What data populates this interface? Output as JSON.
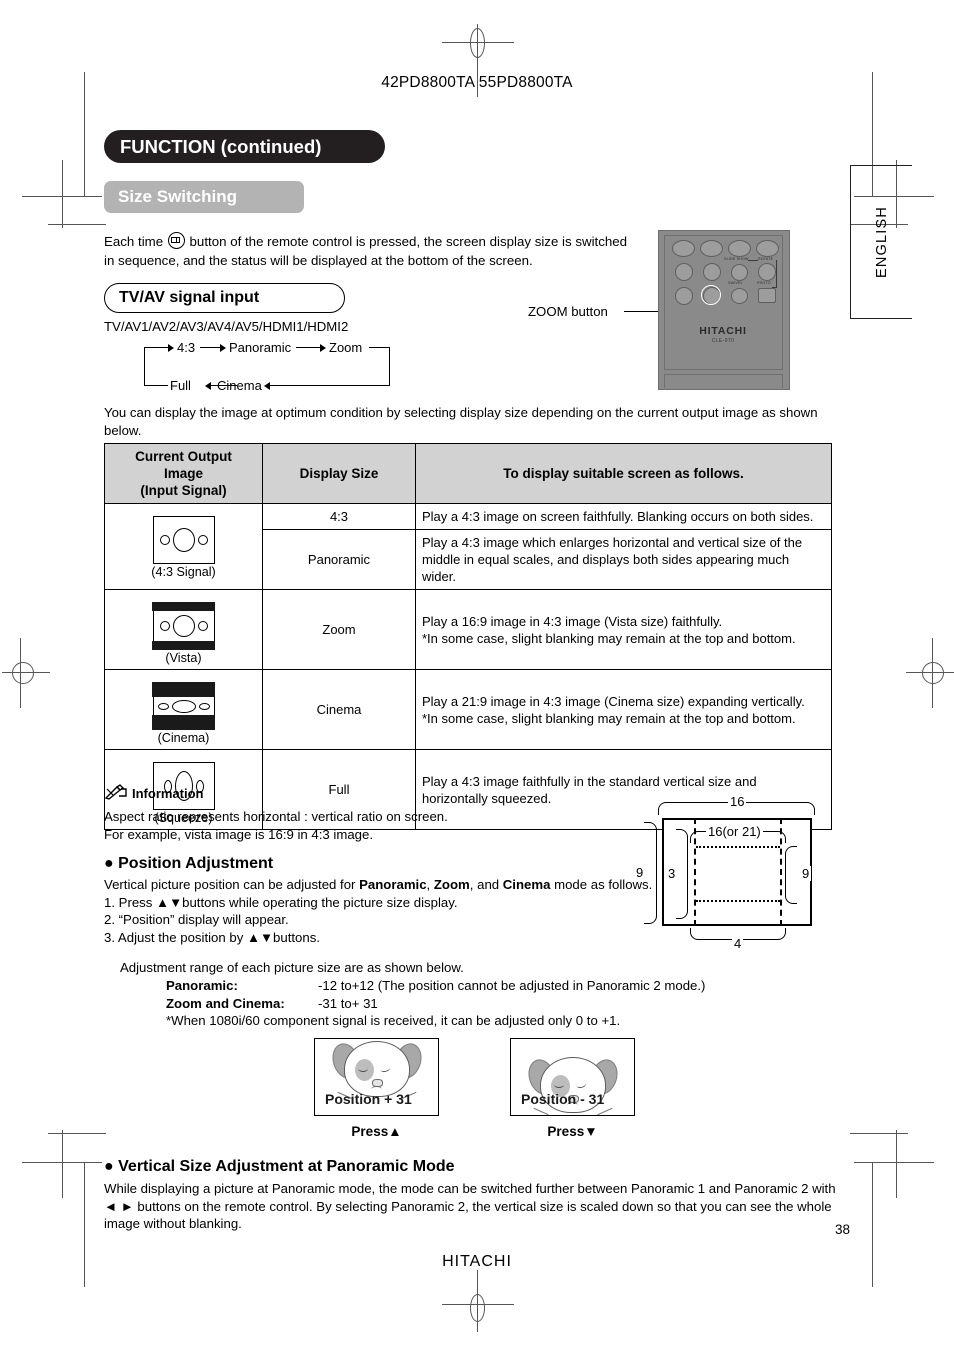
{
  "header": {
    "models": "42PD8800TA  55PD8800TA",
    "title": "FUNCTION (continued)",
    "section": "Size Switching",
    "language_tab": "ENGLISH"
  },
  "intro": {
    "before_icon": "Each time",
    "after_icon": "button of the remote control is pressed, the screen display size is switched in sequence, and the status will be displayed at the bottom of the screen."
  },
  "tvav": {
    "box_label": "TV/AV signal input",
    "inputs": "TV/AV1/AV2/AV3/AV4/AV5/HDMI1/HDMI2",
    "flow": [
      "4:3",
      "Panoramic",
      "Zoom",
      "Cinema",
      "Full"
    ]
  },
  "remote": {
    "callout": "ZOOM button",
    "brand": "HITACHI",
    "model": "CLE-970",
    "labels": {
      "slide_show": "SLIDE SHOW",
      "rotate": "ROTATE",
      "swivel": "SWIVEL",
      "photo": "PHOTO"
    }
  },
  "paragraph_below": "You can display the image at optimum condition by selecting display size depending on the current output image as shown below.",
  "table": {
    "headers": [
      "Current Output Image (Input Signal)",
      "Display Size",
      "To display suitable screen as follows."
    ],
    "header_lines": {
      "col1": [
        "Current Output",
        "Image",
        "(Input Signal)"
      ],
      "col2": "Display Size",
      "col3": "To display suitable screen as follows."
    },
    "rows": [
      {
        "image_label": "(4:3 Signal)",
        "image_type": "4to3",
        "display_size": "4:3",
        "description": "Play a 4:3 image on screen faithfully. Blanking occurs on both sides."
      },
      {
        "image_label": "(4:3 Signal)",
        "image_type": "4to3",
        "display_size": "Panoramic",
        "description": "Play a 4:3 image which enlarges horizontal and vertical size of the middle in equal scales, and displays both sides appearing much wider."
      },
      {
        "image_label": "(Vista)",
        "image_type": "vista",
        "display_size": "Zoom",
        "description": "Play a 16:9 image in 4:3 image (Vista size) faithfully.\n*In some case, slight blanking may remain at the top and bottom."
      },
      {
        "image_label": "(Cinema)",
        "image_type": "cinema",
        "display_size": "Cinema",
        "description": "Play a 21:9 image in 4:3 image (Cinema size) expanding vertically.\n*In some case, slight blanking may remain at the top and bottom."
      },
      {
        "image_label": "(Squeeze)",
        "image_type": "squeeze",
        "display_size": "Full",
        "description": "Play a 4:3 image faithfully in the standard vertical size and horizontally squeezed."
      }
    ]
  },
  "information": {
    "heading": "Information",
    "line1": "Aspect ratio represents horizontal : vertical ratio on screen.",
    "line2": "For example, vista image is 16:9 in 4:3 image."
  },
  "ratio_diagram": {
    "top": "16",
    "inner_top": "16(or 21)",
    "left_outer": "9",
    "left_inner": "3",
    "right": "9",
    "bottom": "4"
  },
  "position_adjustment": {
    "heading": "Position Adjustment",
    "intro_a": "Vertical picture position can be adjusted for ",
    "bold1": "Panoramic",
    "sep1": ", ",
    "bold2": "Zoom",
    "sep2": ", and ",
    "bold3": "Cinema",
    "intro_b": " mode as follows.",
    "step1": "1. Press ▲▼buttons while operating the picture size display.",
    "step2": "2. “Position” display will appear.",
    "step3": "3. Adjust the position by ▲▼buttons.",
    "step3_sub": "Adjustment range of each picture size are as shown below.",
    "range_panoramic_label": "Panoramic",
    "range_panoramic_colon": ":",
    "range_panoramic_value": "-12 to+12  (The position cannot be adjusted in Panoramic 2 mode.)",
    "range_zoomcinema_label_a": "Zoom",
    "range_zoomcinema_label_mid": " and ",
    "range_zoomcinema_label_b": "Cinema",
    "range_zoomcinema_colon": ":",
    "range_zoomcinema_value": "-31 to+ 31",
    "range_note": "*When 1080i/60 component signal is received, it can be adjusted only 0 to +1."
  },
  "osd_examples": [
    {
      "text": "Position  + 31",
      "press": "Press▲"
    },
    {
      "text": "Position  - 31",
      "press": "Press▼"
    }
  ],
  "vertical_size": {
    "heading": "Vertical Size Adjustment at Panoramic Mode",
    "body": "While displaying a picture at Panoramic mode, the mode can be switched further between Panoramic 1 and Panoramic 2 with ◄ ► buttons on the remote control. By selecting Panoramic 2, the vertical size is scaled down so that you can see the whole image without blanking."
  },
  "footer": {
    "page_number": "38",
    "brand": "HITACHI"
  },
  "colors": {
    "title_pill": "#231f20",
    "section_pill": "#b3b3b3",
    "table_header": "#d2d2d2",
    "remote_body": "#8a8a8a"
  }
}
